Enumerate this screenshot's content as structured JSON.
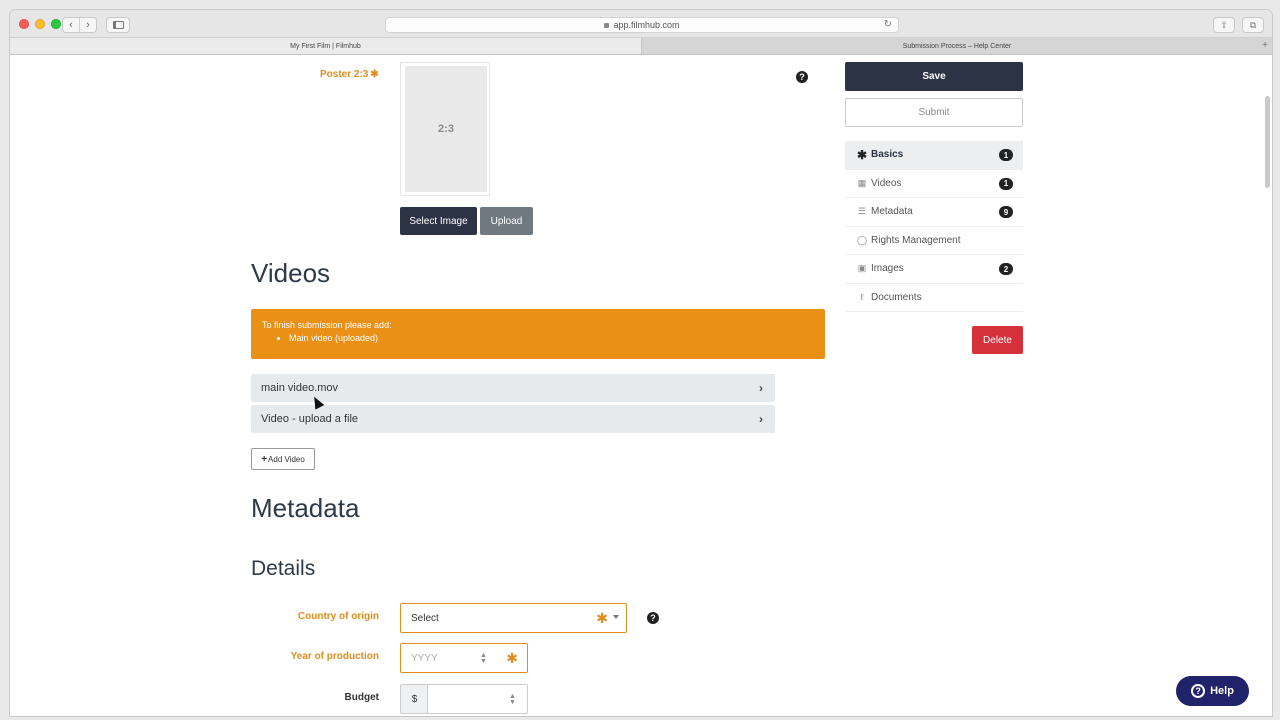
{
  "browser": {
    "url": "app.filmhub.com",
    "tabs": [
      {
        "label": "My First Film | Filmhub"
      },
      {
        "label": "Submission Process – Help Center"
      }
    ]
  },
  "poster": {
    "label": "Poster 2:3",
    "placeholder": "2:3",
    "select_label": "Select Image",
    "upload_label": "Upload"
  },
  "videos": {
    "heading": "Videos",
    "alert_title": "To finish submission please add:",
    "alert_items": [
      "Main video (uploaded)"
    ],
    "rows": [
      {
        "label": "main video.mov"
      },
      {
        "label": "Video - upload a file"
      }
    ],
    "add_label": "Add Video"
  },
  "metadata": {
    "heading": "Metadata",
    "details_heading": "Details",
    "country_label": "Country of origin",
    "country_value": "Select",
    "year_label": "Year of production",
    "year_placeholder": "YYYY",
    "budget_label": "Budget",
    "budget_currency": "$"
  },
  "sidebar": {
    "save_label": "Save",
    "submit_label": "Submit",
    "nav": [
      {
        "label": "Basics",
        "badge": "1",
        "icon": "asterisk-icon"
      },
      {
        "label": "Videos",
        "badge": "1",
        "icon": "film-icon"
      },
      {
        "label": "Metadata",
        "badge": "9",
        "icon": "list-icon"
      },
      {
        "label": "Rights Management",
        "badge": "",
        "icon": "globe-icon"
      },
      {
        "label": "Images",
        "badge": "2",
        "icon": "image-icon"
      },
      {
        "label": "Documents",
        "badge": "",
        "icon": "paperclip-icon"
      }
    ],
    "delete_label": "Delete"
  },
  "help_widget": {
    "label": "Help"
  },
  "colors": {
    "accent": "#e08d1e",
    "dark": "#2b3344",
    "danger": "#d6303a",
    "help": "#20226a"
  }
}
